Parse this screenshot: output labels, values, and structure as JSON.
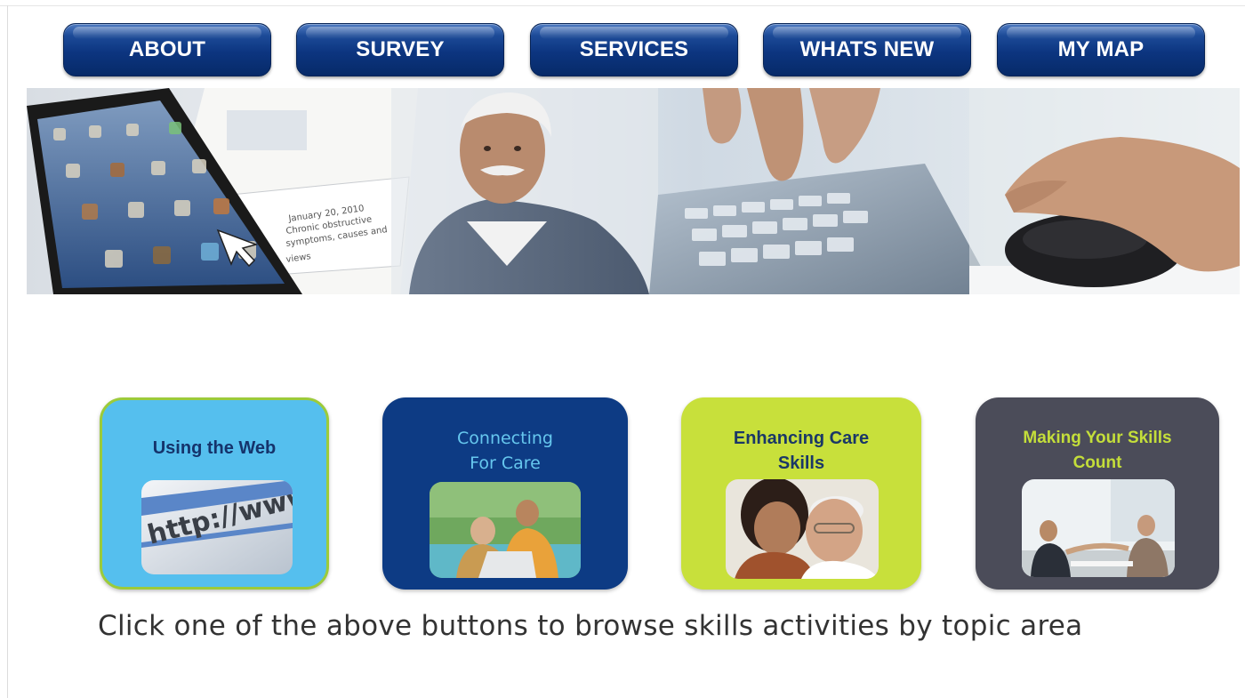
{
  "nav": {
    "items": [
      {
        "label": "ABOUT"
      },
      {
        "label": "SURVEY"
      },
      {
        "label": "SERVICES"
      },
      {
        "label": "WHATS NEW"
      },
      {
        "label": "MY MAP"
      }
    ]
  },
  "banner": {
    "panels": [
      "tablet-screen",
      "senior-man",
      "keyboard-typing",
      "hand-on-mouse"
    ],
    "tablet_text": [
      "January 20, 2010",
      "Chronic obstructive",
      "symptoms, causes and",
      "views"
    ]
  },
  "topics": [
    {
      "title": "Using the Web",
      "photo": "http-address-bar",
      "photo_text": "http://www",
      "color": "#55bfee"
    },
    {
      "title_line1": "Connecting",
      "title_line2": "For Care",
      "photo": "two-men-laptop",
      "color": "#0d3b84"
    },
    {
      "title_line1": "Enhancing Care",
      "title_line2": "Skills",
      "photo": "caregiver-and-senior",
      "color": "#c8e03b"
    },
    {
      "title_line1": "Making Your Skills",
      "title_line2": "Count",
      "photo": "handshake-meeting",
      "color": "#4b4c59"
    }
  ],
  "instruction": "Click one of the above buttons to browse skills activities by topic area"
}
